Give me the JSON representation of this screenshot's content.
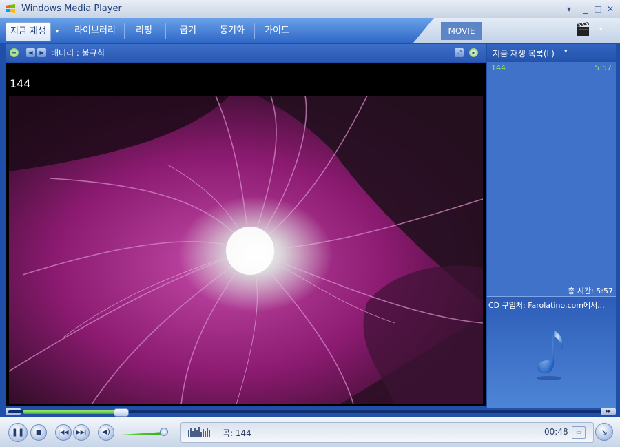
{
  "window": {
    "title": "Windows Media Player",
    "controls": [
      "▾",
      "_",
      "□",
      "✕"
    ]
  },
  "tabs": [
    {
      "label": "지금 재생",
      "active": true
    },
    {
      "label": "라이브러리"
    },
    {
      "label": "리핑"
    },
    {
      "label": "굽기"
    },
    {
      "label": "동기화"
    },
    {
      "label": "가이드"
    }
  ],
  "tab_dropdown": "▾",
  "movie_label": "MOVIE",
  "infostrip": {
    "text": "배터리 : 불규칙"
  },
  "video": {
    "track_title": "144"
  },
  "playlist": {
    "header": "지금 재생 목록(L)",
    "items": [
      {
        "title": "144",
        "duration": "5:57"
      }
    ],
    "total": "총 시간: 5:57",
    "cd_purchase": "CD 구입처: Farolatino.com에서..."
  },
  "status": {
    "track_text": "곡: 144",
    "elapsed": "00:48"
  },
  "progress": {
    "seek_fraction": 0.16,
    "volume_fraction": 0.9
  },
  "colors": {
    "accent": "#2f67c7",
    "progress_green": "#3bb41b",
    "playlist_text": "#95e65e",
    "visual_magenta": "#9a1f7c"
  }
}
